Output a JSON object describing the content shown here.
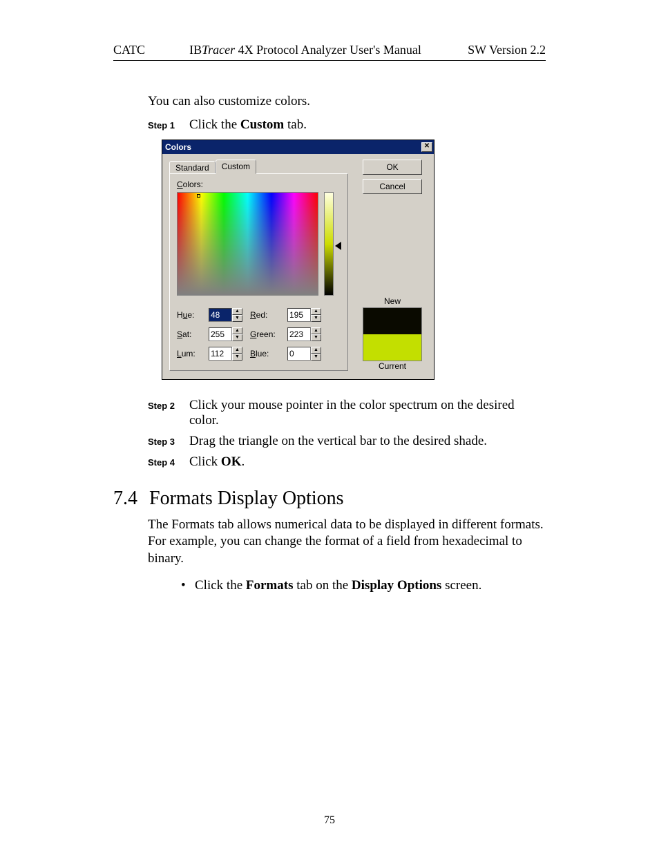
{
  "header": {
    "left": "CATC",
    "center_prefix": "IB",
    "center_italic": "Tracer",
    "center_suffix": " 4X Protocol Analyzer User's Manual",
    "right": "SW Version 2.2"
  },
  "intro": "You can also customize colors.",
  "steps": {
    "s1": {
      "label": "Step 1",
      "pre": "Click the ",
      "bold": "Custom",
      "post": " tab."
    },
    "s2": {
      "label": "Step 2",
      "text": "Click your mouse pointer in the color spectrum on the desired color."
    },
    "s3": {
      "label": "Step 3",
      "text": "Drag the triangle on the vertical bar to the desired shade."
    },
    "s4": {
      "label": "Step 4",
      "pre": "Click ",
      "bold": "OK",
      "post": "."
    }
  },
  "dialog": {
    "title": "Colors",
    "close_glyph": "✕",
    "tabs": {
      "standard": "Standard",
      "custom": "Custom"
    },
    "colors_label": "Colors:",
    "ok": "OK",
    "cancel": "Cancel",
    "new": "New",
    "current": "Current",
    "fields": {
      "hue_label_pre": "H",
      "hue_label_u": "u",
      "hue_label_post": "e:",
      "sat_label_u": "S",
      "sat_label_post": "at:",
      "lum_label_u": "L",
      "lum_label_post": "um:",
      "red_label_u": "R",
      "red_label_post": "ed:",
      "green_label_u": "G",
      "green_label_post": "reen:",
      "blue_label_u": "B",
      "blue_label_post": "lue:",
      "hue": "48",
      "sat": "255",
      "lum": "112",
      "red": "195",
      "green": "223",
      "blue": "0"
    },
    "spin_up": "▲",
    "spin_down": "▼",
    "colors_hex": {
      "new": "#0a0a00",
      "current": "#c3df00"
    }
  },
  "section": {
    "num": "7.4",
    "title": "Formats Display Options",
    "para": "The Formats tab allows numerical data to be displayed in different formats. For example, you can change the format of a field from hexadecimal to binary.",
    "bullet_pre": "Click the ",
    "bullet_b1": "Formats",
    "bullet_mid": " tab on the ",
    "bullet_b2": "Display Options",
    "bullet_post": " screen."
  },
  "page_number": "75"
}
